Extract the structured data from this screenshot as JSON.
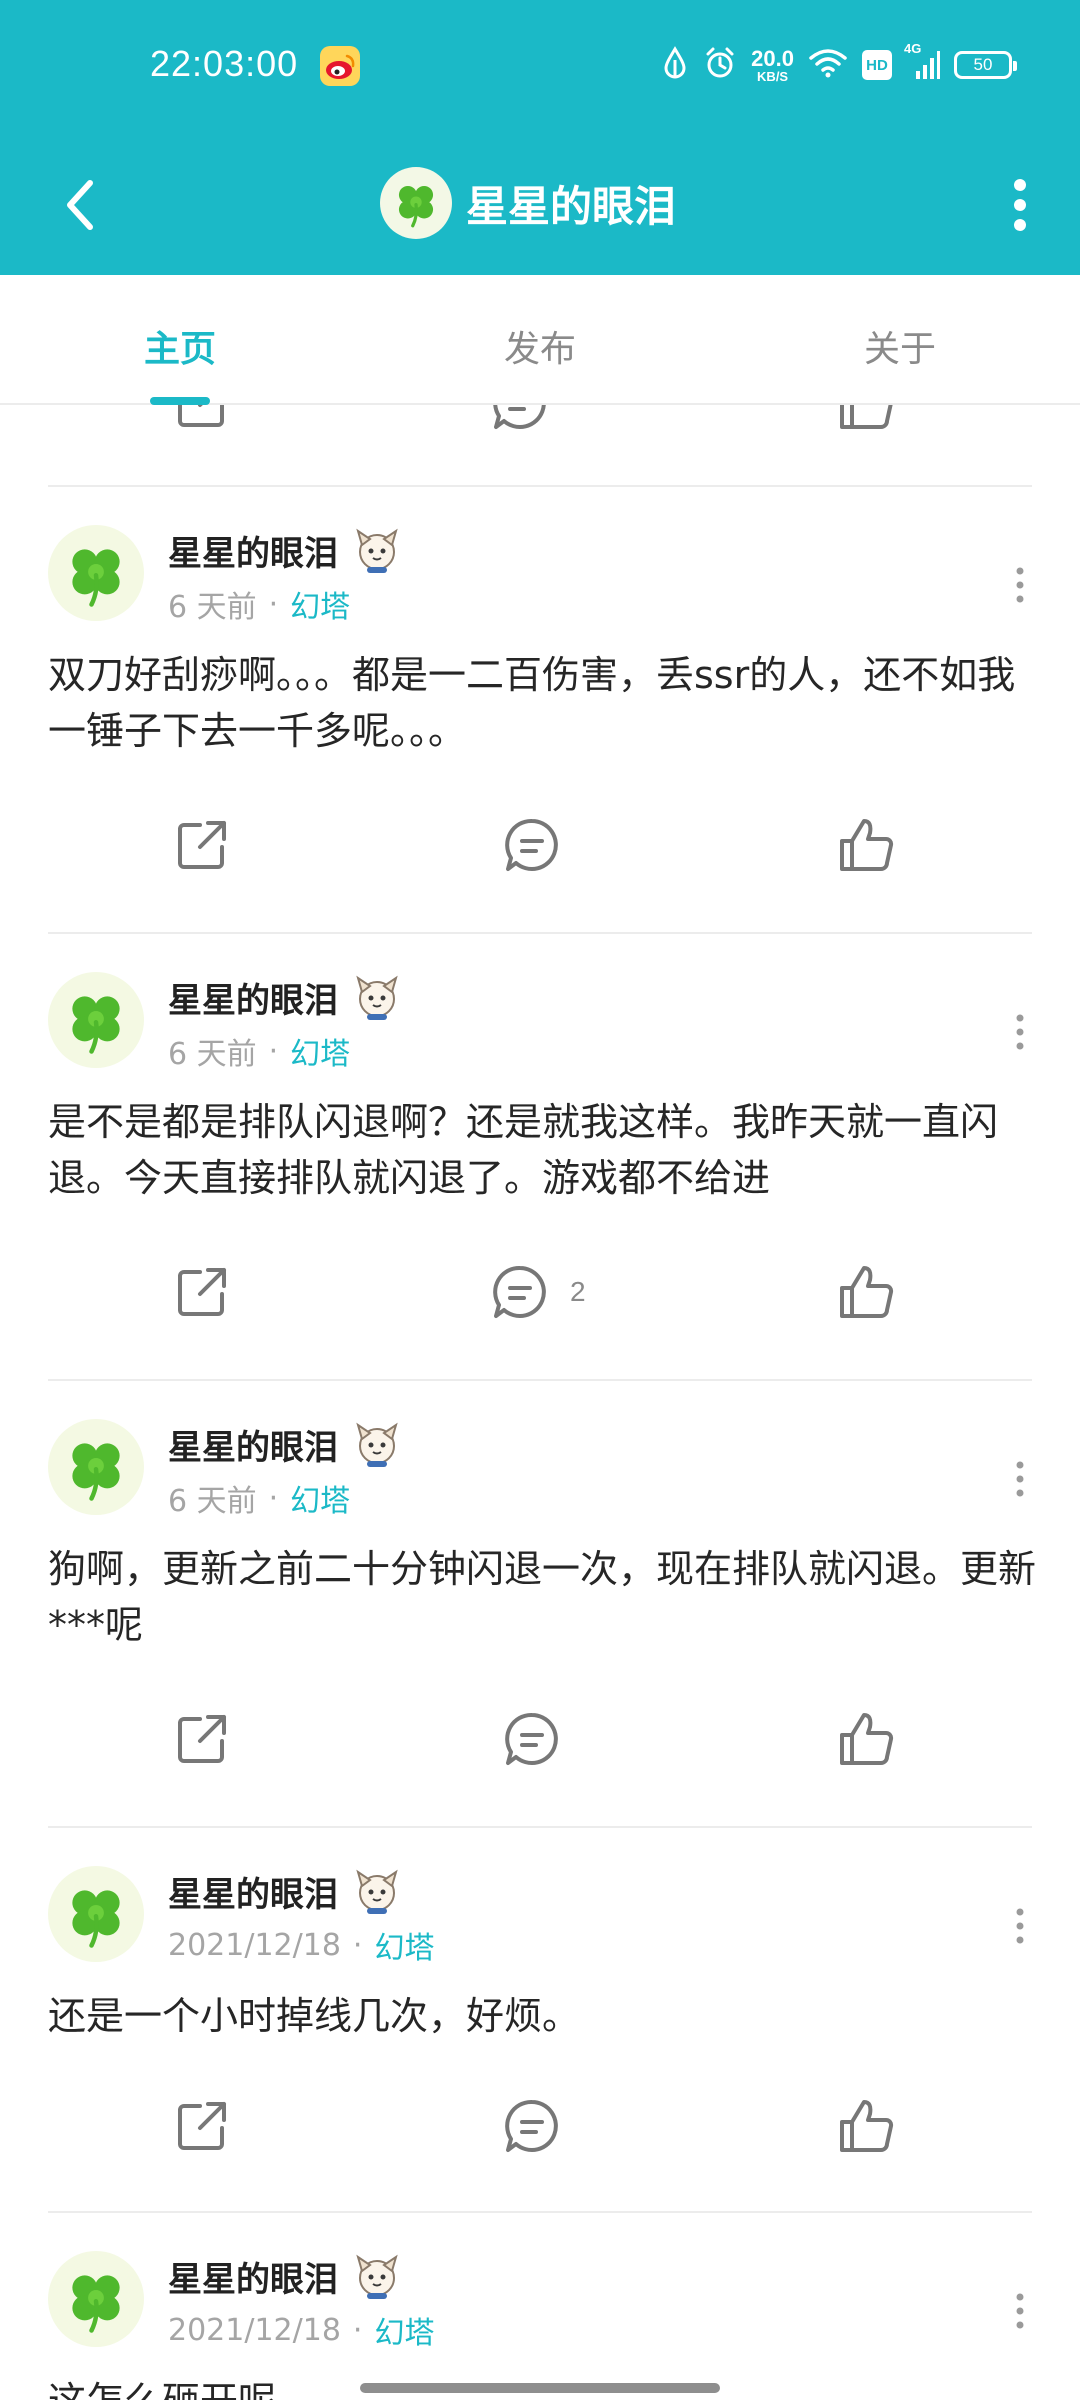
{
  "status_bar": {
    "time": "22:03:00",
    "net_speed_value": "20.0",
    "net_speed_unit": "KB/S",
    "hd": "HD",
    "signal_label": "4G",
    "battery": "50"
  },
  "title_bar": {
    "title": "星星的眼泪"
  },
  "tabs": [
    {
      "label": "主页",
      "active": true
    },
    {
      "label": "发布",
      "active": false
    },
    {
      "label": "关于",
      "active": false
    }
  ],
  "colors": {
    "accent": "#1bb9c7",
    "text": "#262626",
    "muted": "#a5a5a5"
  },
  "posts": [
    {
      "author": "星星的眼泪",
      "time": "6 天前",
      "tag": "幻塔",
      "text": "双刀好刮痧啊。。。都是一二百伤害，丢ssr的人，还不如我一锤子下去一千多呢。。。",
      "comment_count": ""
    },
    {
      "author": "星星的眼泪",
      "time": "6 天前",
      "tag": "幻塔",
      "text": "是不是都是排队闪退啊？还是就我这样。我昨天就一直闪退。今天直接排队就闪退了。游戏都不给进",
      "comment_count": "2"
    },
    {
      "author": "星星的眼泪",
      "time": "6 天前",
      "tag": "幻塔",
      "text": "狗啊，更新之前二十分钟闪退一次，现在排队就闪退。更新***呢",
      "comment_count": ""
    },
    {
      "author": "星星的眼泪",
      "time": "2021/12/18",
      "tag": "幻塔",
      "text": "还是一个小时掉线几次，好烦。",
      "comment_count": ""
    },
    {
      "author": "星星的眼泪",
      "time": "2021/12/18",
      "tag": "幻塔",
      "text": "这怎么砸开呢",
      "comment_count": ""
    }
  ],
  "icons": {
    "back": "chevron-left-icon",
    "more": "more-vertical-icon",
    "share": "share-icon",
    "comment": "comment-icon",
    "like": "thumbs-up-icon",
    "avatar": "clover-icon"
  }
}
